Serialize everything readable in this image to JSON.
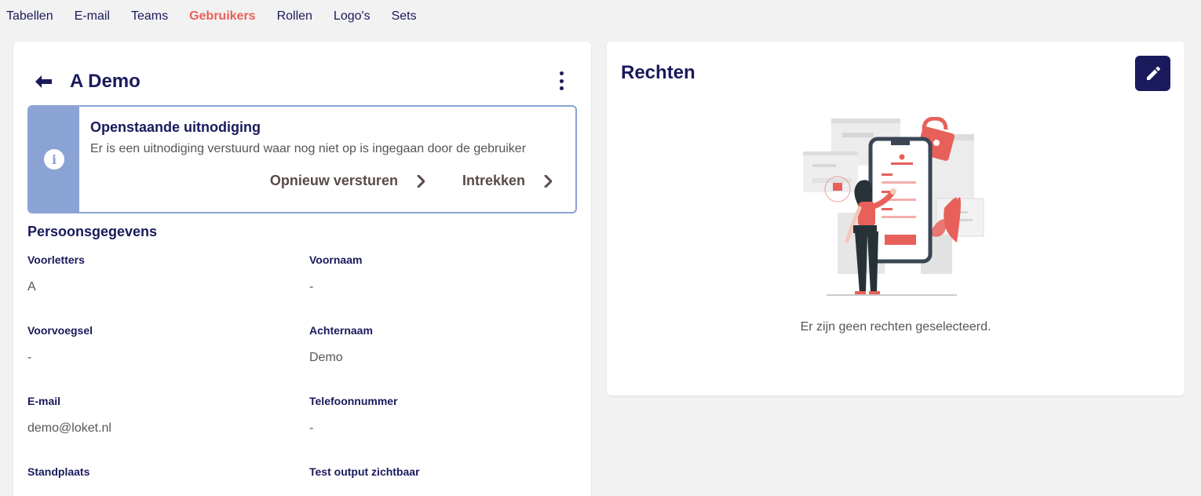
{
  "nav": {
    "items": [
      {
        "label": "Tabellen"
      },
      {
        "label": "E-mail"
      },
      {
        "label": "Teams"
      },
      {
        "label": "Gebruikers"
      },
      {
        "label": "Rollen"
      },
      {
        "label": "Logo's"
      },
      {
        "label": "Sets"
      }
    ],
    "active": "Gebruikers"
  },
  "user": {
    "name": "A Demo"
  },
  "invite": {
    "title": "Openstaande uitnodiging",
    "text": "Er is een uitnodiging verstuurd waar nog niet op is ingegaan door de gebruiker",
    "resend_label": "Opnieuw versturen",
    "revoke_label": "Intrekken",
    "accent": "#8aa3d4"
  },
  "personal": {
    "title": "Persoonsgegevens",
    "fields": [
      {
        "label": "Voorletters",
        "value": "A"
      },
      {
        "label": "Voornaam",
        "value": "-"
      },
      {
        "label": "Voorvoegsel",
        "value": "-"
      },
      {
        "label": "Achternaam",
        "value": "Demo"
      },
      {
        "label": "E-mail",
        "value": "demo@loket.nl"
      },
      {
        "label": "Telefoonnummer",
        "value": "-"
      },
      {
        "label": "Standplaats",
        "value": ""
      },
      {
        "label": "Test output zichtbaar",
        "value": ""
      }
    ]
  },
  "rights": {
    "title": "Rechten",
    "empty_text": "Er zijn geen rechten geselecteerd."
  },
  "colors": {
    "primary": "#1a1a5c",
    "active_nav": "#e8605a",
    "background": "#f2f2f2"
  }
}
